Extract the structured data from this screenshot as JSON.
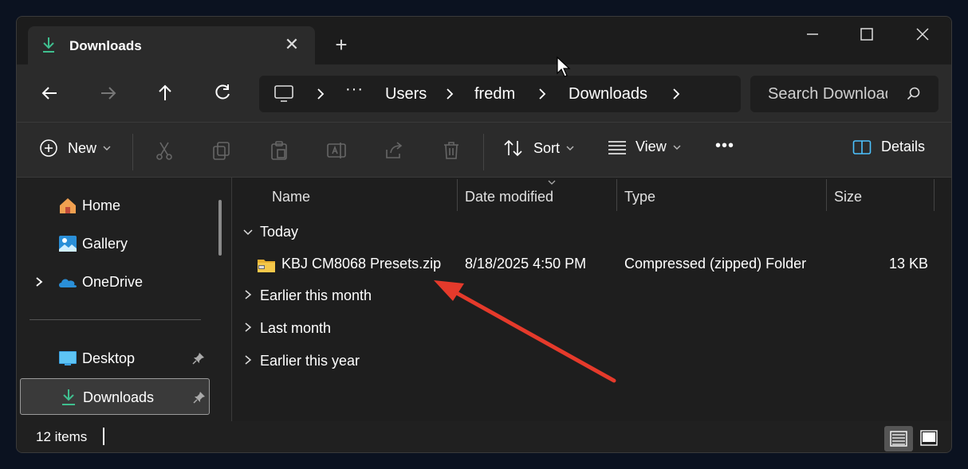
{
  "tab": {
    "title": "Downloads",
    "close": "✕"
  },
  "new_tab": "+",
  "window_controls": {
    "min_icon": "minimize-icon",
    "max_icon": "maximize-icon",
    "close_icon": "close-icon"
  },
  "breadcrumb": {
    "ellipsis": "···",
    "items": [
      "Users",
      "fredm",
      "Downloads"
    ]
  },
  "search": {
    "placeholder": "Search Downloads"
  },
  "toolbar": {
    "new_label": "New",
    "sort_label": "Sort",
    "view_label": "View",
    "more_label": "•••",
    "details_label": "Details"
  },
  "sidebar": {
    "items": [
      {
        "label": "Home",
        "icon": "home-icon"
      },
      {
        "label": "Gallery",
        "icon": "gallery-icon"
      },
      {
        "label": "OneDrive",
        "icon": "onedrive-icon"
      },
      {
        "label": "Desktop",
        "icon": "desktop-icon"
      },
      {
        "label": "Downloads",
        "icon": "downloads-icon"
      }
    ]
  },
  "columns": [
    "Name",
    "Date modified",
    "Type",
    "Size"
  ],
  "groups": {
    "today": "Today",
    "earlier_this_month": "Earlier this month",
    "last_month": "Last month",
    "earlier_this_year": "Earlier this year"
  },
  "file": {
    "name": "KBJ CM8068 Presets.zip",
    "date": "8/18/2025 4:50 PM",
    "type": "Compressed (zipped) Folder",
    "size": "13 KB"
  },
  "status": {
    "count": "12 items"
  },
  "colors": {
    "accent": "#4cc2ff",
    "annotation_arrow": "#e53a2b",
    "download_green": "#3fbf8f"
  }
}
